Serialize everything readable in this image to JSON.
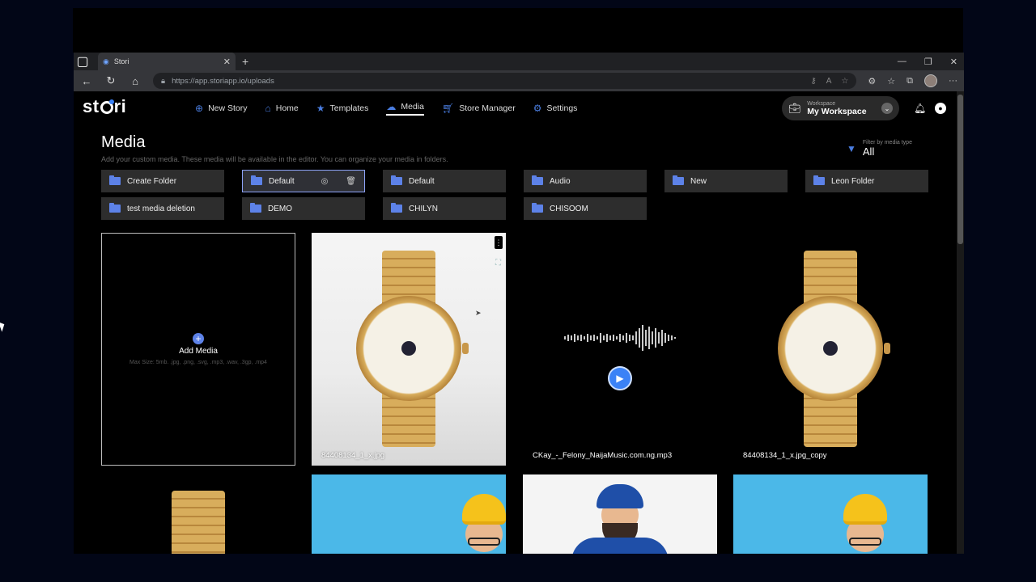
{
  "browser": {
    "tab_title": "Stori",
    "url": "https://app.storiapp.io/uploads"
  },
  "app": {
    "logo": "stori",
    "nav": [
      {
        "label": "New Story",
        "icon": "plus-circle-icon"
      },
      {
        "label": "Home",
        "icon": "home-icon"
      },
      {
        "label": "Templates",
        "icon": "star-icon"
      },
      {
        "label": "Media",
        "icon": "cloud-upload-icon",
        "active": true
      },
      {
        "label": "Store Manager",
        "icon": "cart-icon"
      },
      {
        "label": "Settings",
        "icon": "gear-icon"
      }
    ],
    "workspace": {
      "label": "Workspace",
      "name": "My Workspace"
    },
    "accent_color": "#5d82e8"
  },
  "page": {
    "title": "Media",
    "description": "Add your custom media. These media will be available in the editor. You can organize your media in folders.",
    "filter": {
      "label": "Filter by media type",
      "value": "All"
    }
  },
  "folders": [
    {
      "label": "Create Folder"
    },
    {
      "label": "Default",
      "selected": true
    },
    {
      "label": "Default"
    },
    {
      "label": "Audio"
    },
    {
      "label": "New"
    },
    {
      "label": "Leon Folder"
    },
    {
      "label": "test media deletion"
    },
    {
      "label": "DEMO"
    },
    {
      "label": "CHILYN"
    },
    {
      "label": "CHISOOM"
    }
  ],
  "add_media": {
    "label": "Add Media",
    "hint": "Max Size: 5mb. .jpg, .png, .svg, .mp3, .wav, .3gp, .mp4"
  },
  "media": [
    {
      "name": "84408134_1_x.jpg",
      "type": "image"
    },
    {
      "name": "CKay_-_Felony_NaijaMusic.com.ng.mp3",
      "type": "audio"
    },
    {
      "name": "84408134_1_x.jpg_copy",
      "type": "image"
    }
  ]
}
